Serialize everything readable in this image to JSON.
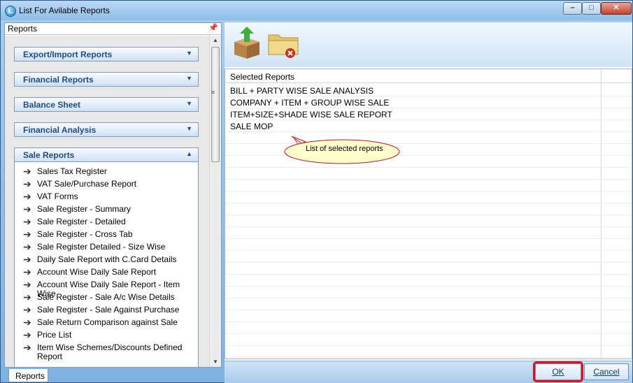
{
  "window": {
    "title": "List For Avilable Reports",
    "icon_letter": "L"
  },
  "left_pane": {
    "header": "Reports",
    "pin_icon": "pin-icon",
    "groups": [
      {
        "label": "Export/Import Reports",
        "state": "collapsed"
      },
      {
        "label": "Financial Reports",
        "state": "collapsed"
      },
      {
        "label": "Balance Sheet",
        "state": "collapsed"
      },
      {
        "label": "Financial Analysis",
        "state": "collapsed"
      },
      {
        "label": "Sale Reports",
        "state": "expanded"
      }
    ],
    "sale_report_items": [
      "Sales Tax Register",
      "VAT Sale/Purchase Report",
      "VAT Forms",
      "Sale Register - Summary",
      "Sale Register - Detailed",
      "Sale Register - Cross Tab",
      "Sale Register Detailed - Size Wise",
      "Daily Sale Report with C.Card Details",
      "Account Wise Daily Sale Report",
      "Account Wise Daily Sale Report - Item Wise",
      "Sale Register - Sale A/c Wise Details",
      "Sale Register - Sale Against Purchase",
      "Sale Return Comparison against Sale",
      "Price List",
      "Item Wise Schemes/Discounts Defined Report"
    ],
    "bottom_tab": "Reports"
  },
  "toolbar": {
    "icons": [
      "add-to-box-icon",
      "remove-folder-icon"
    ]
  },
  "grid": {
    "column_header": "Selected Reports",
    "rows": [
      "BILL + PARTY WISE SALE ANALYSIS",
      "COMPANY + ITEM + GROUP WISE SALE",
      "ITEM+SIZE+SHADE WISE SALE REPORT",
      "SALE MOP"
    ]
  },
  "callout": {
    "text": "List of selected reports"
  },
  "footer": {
    "ok_label": "OK",
    "cancel_label": "Cancel"
  },
  "colors": {
    "accent": "#1f4c86",
    "highlight": "#e01020"
  }
}
